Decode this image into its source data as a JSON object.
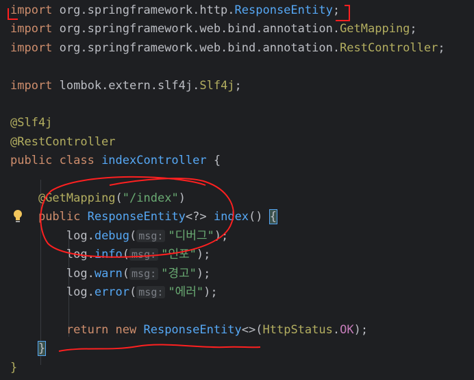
{
  "editor": {
    "lines": [
      {
        "parts": [
          {
            "t": "import",
            "c": "kw"
          },
          {
            "t": " org.springframework.http.",
            "c": ""
          },
          {
            "t": "ResponseEntity",
            "c": "cls"
          },
          {
            "t": ";",
            "c": ""
          }
        ]
      },
      {
        "parts": [
          {
            "t": "import",
            "c": "kw"
          },
          {
            "t": " org.springframework.web.bind.annotation.",
            "c": ""
          },
          {
            "t": "GetMapping",
            "c": "ann"
          },
          {
            "t": ";",
            "c": ""
          }
        ]
      },
      {
        "parts": [
          {
            "t": "import",
            "c": "kw"
          },
          {
            "t": " org.springframework.web.bind.annotation.",
            "c": ""
          },
          {
            "t": "RestController",
            "c": "ann"
          },
          {
            "t": ";",
            "c": ""
          }
        ]
      },
      {
        "parts": []
      },
      {
        "parts": [
          {
            "t": "import",
            "c": "kw"
          },
          {
            "t": " lombok.extern.slf4j.",
            "c": ""
          },
          {
            "t": "Slf4j",
            "c": "ann"
          },
          {
            "t": ";",
            "c": ""
          }
        ]
      },
      {
        "parts": []
      },
      {
        "parts": [
          {
            "t": "@Slf4j",
            "c": "ann"
          }
        ]
      },
      {
        "parts": [
          {
            "t": "@RestController",
            "c": "ann"
          }
        ]
      },
      {
        "parts": [
          {
            "t": "public class ",
            "c": "kw"
          },
          {
            "t": "indexController",
            "c": "cls"
          },
          {
            "t": " {",
            "c": ""
          }
        ]
      },
      {
        "parts": []
      },
      {
        "parts": [
          {
            "t": "    ",
            "c": ""
          },
          {
            "t": "@GetMapping",
            "c": "ann"
          },
          {
            "t": "(",
            "c": ""
          },
          {
            "t": "\"/index\"",
            "c": "str"
          },
          {
            "t": ")",
            "c": ""
          }
        ]
      },
      {
        "parts": [
          {
            "t": "    ",
            "c": ""
          },
          {
            "t": "public ",
            "c": "kw"
          },
          {
            "t": "ResponseEntity",
            "c": "cls"
          },
          {
            "t": "<?> ",
            "c": ""
          },
          {
            "t": "index",
            "c": "method"
          },
          {
            "t": "() ",
            "c": ""
          },
          {
            "t": "{",
            "c": "brace-hl"
          }
        ]
      },
      {
        "parts": [
          {
            "t": "        log.",
            "c": ""
          },
          {
            "t": "debug",
            "c": "method"
          },
          {
            "t": "(",
            "c": ""
          },
          {
            "t": "msg:",
            "c": "hint"
          },
          {
            "t": "\"디버그\"",
            "c": "str"
          },
          {
            "t": ");",
            "c": ""
          }
        ]
      },
      {
        "parts": [
          {
            "t": "        log.",
            "c": ""
          },
          {
            "t": "info",
            "c": "method"
          },
          {
            "t": "(",
            "c": ""
          },
          {
            "t": "msg:",
            "c": "hint"
          },
          {
            "t": "\"인포\"",
            "c": "str"
          },
          {
            "t": ");",
            "c": ""
          }
        ]
      },
      {
        "parts": [
          {
            "t": "        log.",
            "c": ""
          },
          {
            "t": "warn",
            "c": "method"
          },
          {
            "t": "(",
            "c": ""
          },
          {
            "t": "msg:",
            "c": "hint"
          },
          {
            "t": "\"경고\"",
            "c": "str"
          },
          {
            "t": ");",
            "c": ""
          }
        ]
      },
      {
        "parts": [
          {
            "t": "        log.",
            "c": ""
          },
          {
            "t": "error",
            "c": "method"
          },
          {
            "t": "(",
            "c": ""
          },
          {
            "t": "msg:",
            "c": "hint"
          },
          {
            "t": "\"에러\"",
            "c": "str"
          },
          {
            "t": ");",
            "c": ""
          }
        ]
      },
      {
        "parts": []
      },
      {
        "parts": [
          {
            "t": "        ",
            "c": ""
          },
          {
            "t": "return new ",
            "c": "kw"
          },
          {
            "t": "ResponseEntity",
            "c": "cls"
          },
          {
            "t": "<>(",
            "c": ""
          },
          {
            "t": "HttpStatus",
            "c": "ann"
          },
          {
            "t": ".",
            "c": ""
          },
          {
            "t": "OK",
            "c": "const"
          },
          {
            "t": ");",
            "c": ""
          }
        ]
      },
      {
        "parts": [
          {
            "t": "    ",
            "c": ""
          },
          {
            "t": "}",
            "c": "brace-hl"
          }
        ]
      },
      {
        "parts": [
          {
            "t": "}",
            "c": "ann"
          }
        ]
      }
    ]
  },
  "colors": {
    "background": "#1e1f22",
    "keyword": "#cf8e6d",
    "class": "#56a8f5",
    "annotation": "#b3ae60",
    "string": "#6aab73",
    "annotation_pen": "#ff2020"
  },
  "icons": {
    "intention": "lightbulb-icon"
  }
}
